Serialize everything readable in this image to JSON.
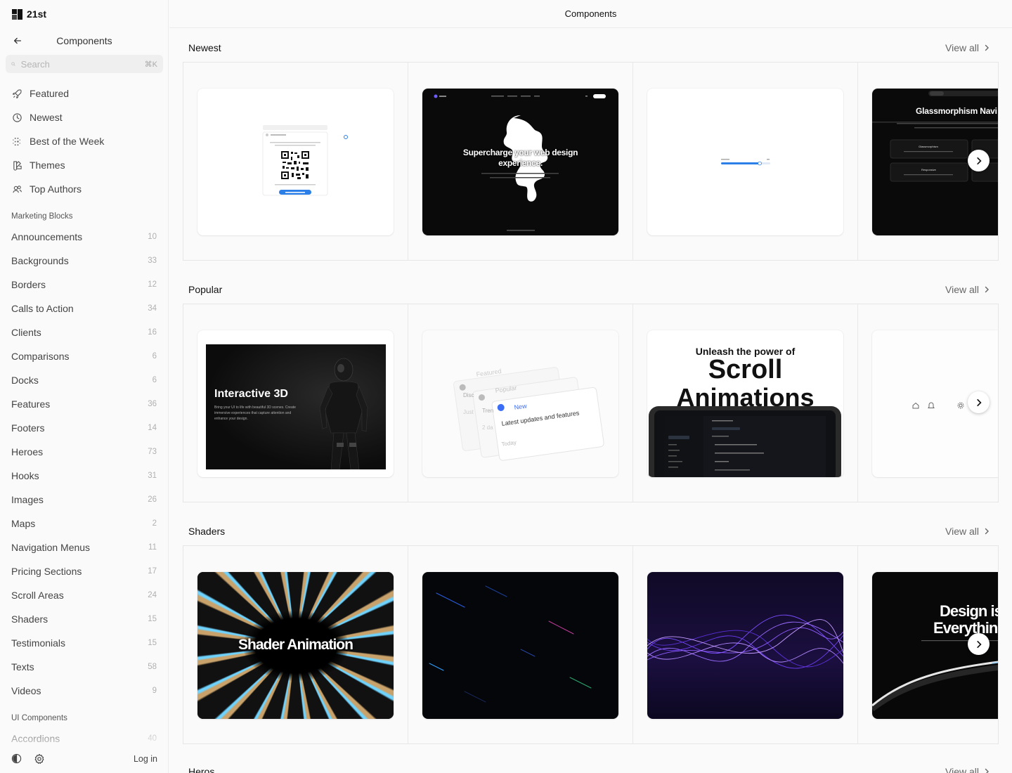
{
  "brand": {
    "name": "21st"
  },
  "sidebar": {
    "title": "Components",
    "search_placeholder": "Search",
    "search_shortcut": "⌘K",
    "nav": [
      {
        "label": "Featured",
        "icon": "rocket-icon"
      },
      {
        "label": "Newest",
        "icon": "clock-icon"
      },
      {
        "label": "Best of the Week",
        "icon": "sparkle-icon"
      },
      {
        "label": "Themes",
        "icon": "palette-icon"
      },
      {
        "label": "Top Authors",
        "icon": "users-icon"
      }
    ],
    "marketing_label": "Marketing Blocks",
    "marketing": [
      {
        "label": "Announcements",
        "count": "10"
      },
      {
        "label": "Backgrounds",
        "count": "33"
      },
      {
        "label": "Borders",
        "count": "12"
      },
      {
        "label": "Calls to Action",
        "count": "34"
      },
      {
        "label": "Clients",
        "count": "16"
      },
      {
        "label": "Comparisons",
        "count": "6"
      },
      {
        "label": "Docks",
        "count": "6"
      },
      {
        "label": "Features",
        "count": "36"
      },
      {
        "label": "Footers",
        "count": "14"
      },
      {
        "label": "Heroes",
        "count": "73"
      },
      {
        "label": "Hooks",
        "count": "31"
      },
      {
        "label": "Images",
        "count": "26"
      },
      {
        "label": "Maps",
        "count": "2"
      },
      {
        "label": "Navigation Menus",
        "count": "11"
      },
      {
        "label": "Pricing Sections",
        "count": "17"
      },
      {
        "label": "Scroll Areas",
        "count": "24"
      },
      {
        "label": "Shaders",
        "count": "15"
      },
      {
        "label": "Testimonials",
        "count": "15"
      },
      {
        "label": "Texts",
        "count": "58"
      },
      {
        "label": "Videos",
        "count": "9"
      }
    ],
    "ui_label": "UI Components",
    "ui": [
      {
        "label": "Accordions",
        "count": "40"
      }
    ],
    "footer": {
      "login": "Log in",
      "icons": [
        "theme-toggle-icon",
        "settings-icon"
      ]
    }
  },
  "main": {
    "title": "Components",
    "view_all": "View all",
    "sections": [
      {
        "title": "Newest"
      },
      {
        "title": "Popular"
      },
      {
        "title": "Shaders"
      },
      {
        "title": "Heros"
      }
    ]
  },
  "cards": {
    "newest_2": {
      "headline": "Supercharge your web design experience."
    },
    "newest_4": {
      "headline": "Glassmorphism Navi",
      "item1": "Glassmorphism",
      "item2": "Responsive"
    },
    "popular_1": {
      "headline": "Interactive 3D",
      "body": "Bring your UI to life with beautiful 3D scenes. Create immersive experiences that capture attention and enhance your design."
    },
    "popular_2": {
      "tag1": "Featured",
      "tag2": "Popular",
      "tag3": "New",
      "line1": "Latest updates and features",
      "line2": "Today",
      "side1": "Disc",
      "side2": "Tren",
      "side3": "Just",
      "side4": "2 da"
    },
    "popular_3": {
      "line1": "Unleash the power of",
      "line2": "Scroll",
      "line3": "Animations"
    },
    "shaders_1": {
      "headline": "Shader Animation"
    },
    "shaders_4": {
      "line1": "Design is",
      "line2": "Everythin"
    }
  }
}
